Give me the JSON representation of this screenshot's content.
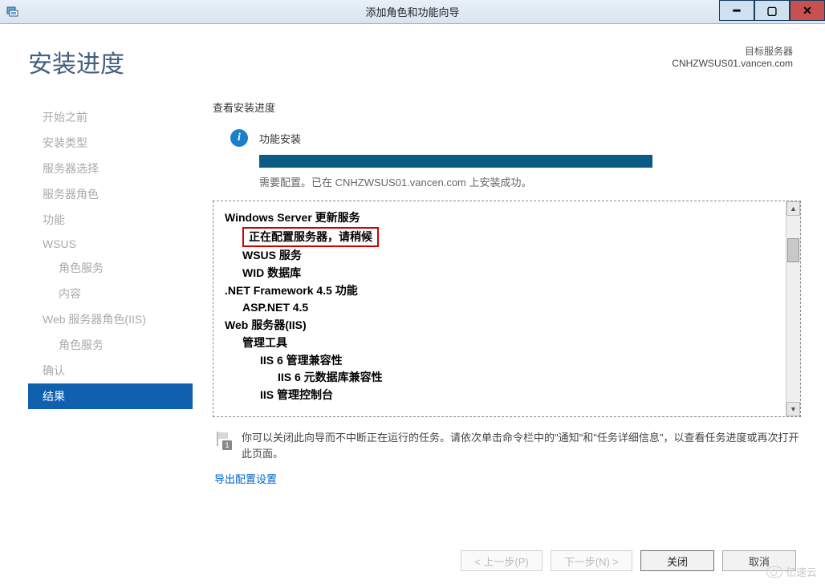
{
  "titlebar": {
    "title": "添加角色和功能向导"
  },
  "header": {
    "page_title": "安装进度",
    "target_label": "目标服务器",
    "target_host": "CNHZWSUS01.vancen.com"
  },
  "sidenav": {
    "items": [
      {
        "label": "开始之前",
        "state": "disabled",
        "sub": false
      },
      {
        "label": "安装类型",
        "state": "disabled",
        "sub": false
      },
      {
        "label": "服务器选择",
        "state": "disabled",
        "sub": false
      },
      {
        "label": "服务器角色",
        "state": "disabled",
        "sub": false
      },
      {
        "label": "功能",
        "state": "disabled",
        "sub": false
      },
      {
        "label": "WSUS",
        "state": "disabled",
        "sub": false
      },
      {
        "label": "角色服务",
        "state": "disabled",
        "sub": true
      },
      {
        "label": "内容",
        "state": "disabled",
        "sub": true
      },
      {
        "label": "Web 服务器角色(IIS)",
        "state": "disabled",
        "sub": false
      },
      {
        "label": "角色服务",
        "state": "disabled",
        "sub": true
      },
      {
        "label": "确认",
        "state": "disabled",
        "sub": false
      },
      {
        "label": "结果",
        "state": "current",
        "sub": false
      }
    ]
  },
  "progress": {
    "section_title": "查看安装进度",
    "status_label": "功能安装",
    "message": "需要配置。已在 CNHZWSUS01.vancen.com 上安装成功。"
  },
  "details": {
    "lines": [
      {
        "text": "Windows Server 更新服务",
        "level": 0
      },
      {
        "text": "正在配置服务器，请稍候",
        "level": 1,
        "highlight": true
      },
      {
        "text": "WSUS 服务",
        "level": 1
      },
      {
        "text": "WID 数据库",
        "level": 1
      },
      {
        "text": ".NET Framework 4.5 功能",
        "level": 0
      },
      {
        "text": "ASP.NET 4.5",
        "level": 1
      },
      {
        "text": "Web 服务器(IIS)",
        "level": 0
      },
      {
        "text": "管理工具",
        "level": 1
      },
      {
        "text": "IIS 6 管理兼容性",
        "level": 2
      },
      {
        "text": "IIS 6 元数据库兼容性",
        "level": 3
      },
      {
        "text": "IIS 管理控制台",
        "level": 2
      }
    ]
  },
  "note": {
    "text": "你可以关闭此向导而不中断正在运行的任务。请依次单击命令栏中的\"通知\"和\"任务详细信息\"，以查看任务进度或再次打开此页面。",
    "badge": "1"
  },
  "links": {
    "export": "导出配置设置"
  },
  "buttons": {
    "prev": "< 上一步(P)",
    "next": "下一步(N) >",
    "close": "关闭",
    "cancel": "取消"
  },
  "watermark": "亿速云"
}
